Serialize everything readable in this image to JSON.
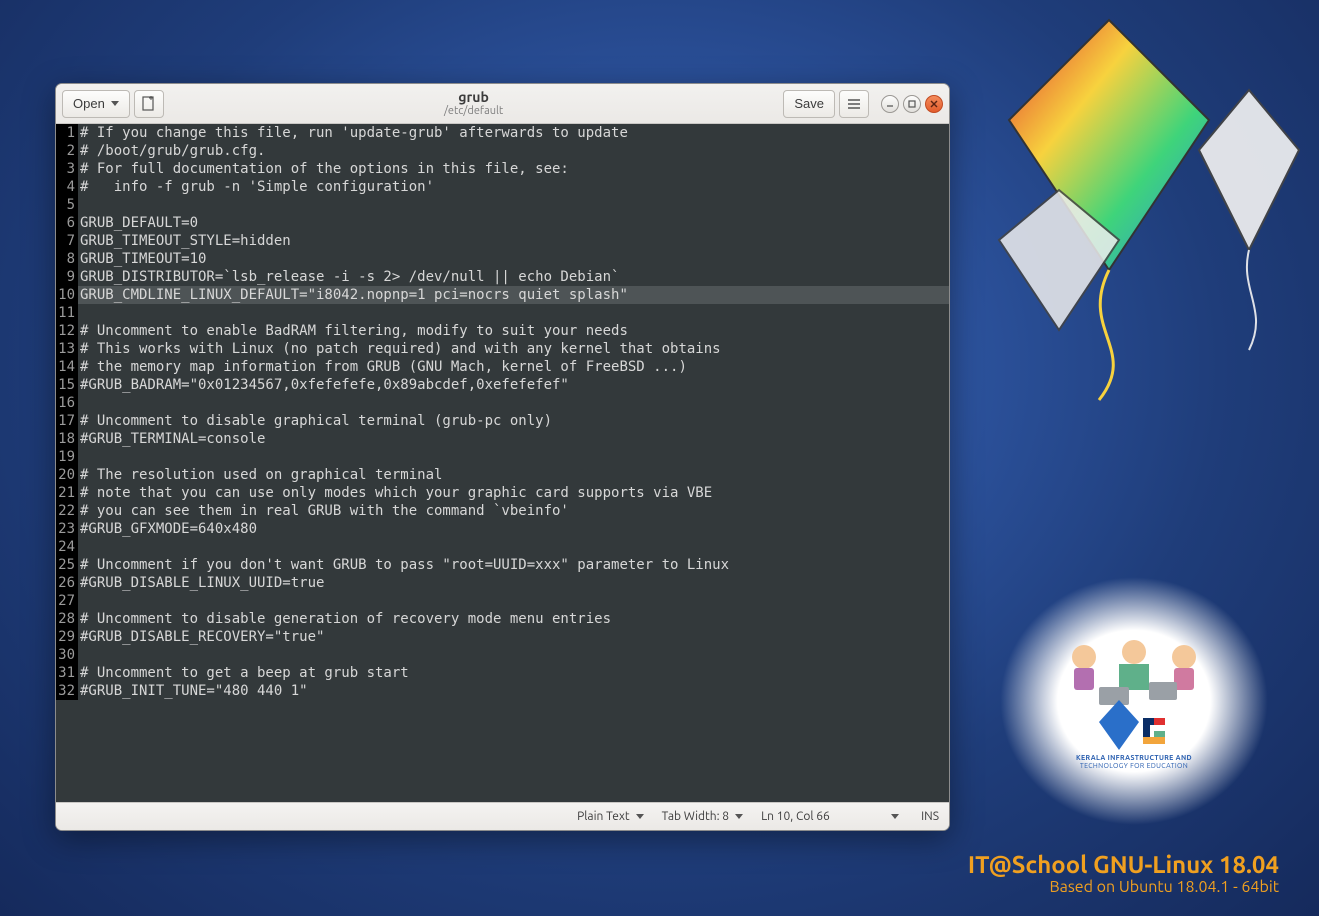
{
  "desktop": {
    "branding_line1": "IT@School GNU-Linux 18.04",
    "branding_line2": "Based on Ubuntu 18.04.1 - 64bit",
    "kite_logo_line1": "KERALA INFRASTRUCTURE AND",
    "kite_logo_line2": "TECHNOLOGY FOR EDUCATION"
  },
  "titlebar": {
    "open_label": "Open",
    "save_label": "Save",
    "title": "grub",
    "subtitle": "/etc/default"
  },
  "statusbar": {
    "syntax": "Plain Text",
    "tabwidth": "Tab Width: 8",
    "cursor": "Ln 10, Col 66",
    "mode": "INS"
  },
  "editor": {
    "highlighted_line": 10,
    "lines": [
      "# If you change this file, run 'update-grub' afterwards to update",
      "# /boot/grub/grub.cfg.",
      "# For full documentation of the options in this file, see:",
      "#   info -f grub -n 'Simple configuration'",
      "",
      "GRUB_DEFAULT=0",
      "GRUB_TIMEOUT_STYLE=hidden",
      "GRUB_TIMEOUT=10",
      "GRUB_DISTRIBUTOR=`lsb_release -i -s 2> /dev/null || echo Debian`",
      "GRUB_CMDLINE_LINUX_DEFAULT=\"i8042.nopnp=1 pci=nocrs quiet splash\"",
      "",
      "# Uncomment to enable BadRAM filtering, modify to suit your needs",
      "# This works with Linux (no patch required) and with any kernel that obtains",
      "# the memory map information from GRUB (GNU Mach, kernel of FreeBSD ...)",
      "#GRUB_BADRAM=\"0x01234567,0xfefefefe,0x89abcdef,0xefefefef\"",
      "",
      "# Uncomment to disable graphical terminal (grub-pc only)",
      "#GRUB_TERMINAL=console",
      "",
      "# The resolution used on graphical terminal",
      "# note that you can use only modes which your graphic card supports via VBE",
      "# you can see them in real GRUB with the command `vbeinfo'",
      "#GRUB_GFXMODE=640x480",
      "",
      "# Uncomment if you don't want GRUB to pass \"root=UUID=xxx\" parameter to Linux",
      "#GRUB_DISABLE_LINUX_UUID=true",
      "",
      "# Uncomment to disable generation of recovery mode menu entries",
      "#GRUB_DISABLE_RECOVERY=\"true\"",
      "",
      "# Uncomment to get a beep at grub start",
      "#GRUB_INIT_TUNE=\"480 440 1\""
    ]
  }
}
